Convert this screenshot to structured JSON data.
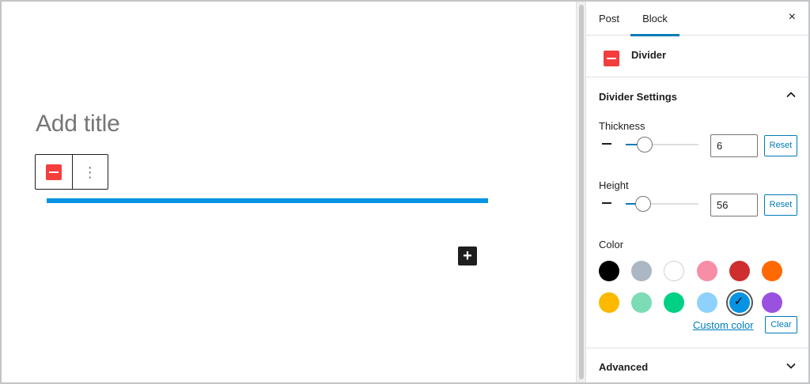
{
  "editor": {
    "title_placeholder": "Add title",
    "toolbar": {
      "block_icon": "divider-icon",
      "options_icon": "more-vertical-icon",
      "options_glyph": "⋮"
    },
    "divider": {
      "color": "#0693e3"
    },
    "inserter": {
      "icon": "plus-icon",
      "glyph": "+"
    }
  },
  "sidebar": {
    "tabs": [
      {
        "label": "Post",
        "active": false
      },
      {
        "label": "Block",
        "active": true
      }
    ],
    "close_glyph": "×",
    "block": {
      "name": "Divider",
      "icon": "divider-icon",
      "icon_color": "#f43e3e"
    },
    "divider_settings": {
      "title": "Divider Settings",
      "thickness": {
        "label": "Thickness",
        "value": "6",
        "reset_label": "Reset",
        "slider_fraction": 0.26
      },
      "height": {
        "label": "Height",
        "value": "56",
        "reset_label": "Reset",
        "slider_fraction": 0.24
      },
      "color": {
        "label": "Color",
        "swatches": [
          {
            "name": "black",
            "hex": "#000000"
          },
          {
            "name": "cyan-bluish-gray",
            "hex": "#abb8c3"
          },
          {
            "name": "white",
            "hex": "#ffffff"
          },
          {
            "name": "pale-pink",
            "hex": "#f78da7"
          },
          {
            "name": "vivid-red",
            "hex": "#cf2e2e"
          },
          {
            "name": "luminous-vivid-orange",
            "hex": "#ff6900"
          },
          {
            "name": "luminous-vivid-amber",
            "hex": "#fcb900"
          },
          {
            "name": "light-green-cyan",
            "hex": "#7bdcb5"
          },
          {
            "name": "vivid-green-cyan",
            "hex": "#00d084"
          },
          {
            "name": "pale-cyan-blue",
            "hex": "#8ed1fc"
          },
          {
            "name": "vivid-cyan-blue",
            "hex": "#0693e3",
            "selected": true
          },
          {
            "name": "vivid-purple",
            "hex": "#9b51e0"
          }
        ],
        "custom_color_label": "Custom color",
        "clear_label": "Clear"
      }
    },
    "advanced": {
      "title": "Advanced"
    }
  }
}
